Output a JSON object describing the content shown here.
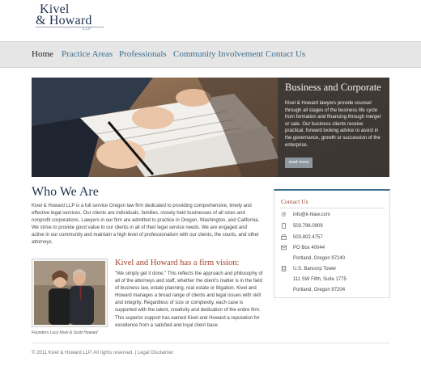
{
  "logo": {
    "line1": "Kivel",
    "line2": "& Howard",
    "llp": "LLP"
  },
  "nav": {
    "items": [
      {
        "label": "Home",
        "active": true
      },
      {
        "label": "Practice Areas"
      },
      {
        "label": "Professionals"
      },
      {
        "label": "Community Involvement"
      },
      {
        "label": "Contact Us"
      }
    ]
  },
  "hero": {
    "title": "Business and Corporate",
    "body": "Kivel & Howard lawyers provide counsel through all stages of the business life cycle from formation and financing through merger or sale. Our business clients receive practical, forward looking advice to assist in the governance, growth or succession of the enterprise.",
    "button": "read more"
  },
  "about": {
    "heading": "Who We Are",
    "intro": "Kivel & Howard LLP is a full service Oregon law firm dedicated to providing comprehensive, timely and effective legal services. Our clients are individuals, families, closely held businesses of all sizes and nonprofit corporations. Lawyers in our firm are admitted to practice in Oregon, Washington, and California. We strive to provide good value to our clients in all of their legal service needs. We are engaged and active in our community and maintain a high level of professionalism with our clients, the courts, and other attorneys.",
    "photo_caption": "Founders Lucy Kivel & Scott Howard",
    "vision_heading": "Kivel and Howard has a firm vision:",
    "vision_text": "\"We simply get it done.\" This reflects the approach and philosophy of all of the attorneys and staff, whether the client's matter is in the field of business law, estate planning, real estate or litigation. Kivel and Howard manages a broad range of clients and legal issues with skill and integrity. Regardless of size or complexity, each case is supported with the talent, creativity and dedication of the entire firm. This superior support has earned Kivel and Howard a reputation for excellence from a satisfied and loyal client base."
  },
  "contact": {
    "title": "Contact Us",
    "email": "info@k-hlaw.com",
    "phone": "503.796.0909",
    "fax": "503.802.4757",
    "pobox": "PO Box 40044",
    "pobox_city": "Portland, Oregon 97240",
    "building": "U.S. Bancorp Tower",
    "street": "111 SW Fifth, Suite 1775",
    "street_city": "Portland, Oregon 97204",
    "icons": [
      "email-icon",
      "phone-icon",
      "fax-icon",
      "mailbox-icon",
      "building-icon"
    ]
  },
  "footer": {
    "copyright": "© 2011 Kivel & Howard LLP. All rights reserved.",
    "divider": " | ",
    "link": "Legal Disclaimer"
  },
  "colors": {
    "nav_link": "#3c6e8f",
    "heading": "#1f3050",
    "accent": "#a0412a",
    "nav_bg": "#e6e6e6"
  }
}
